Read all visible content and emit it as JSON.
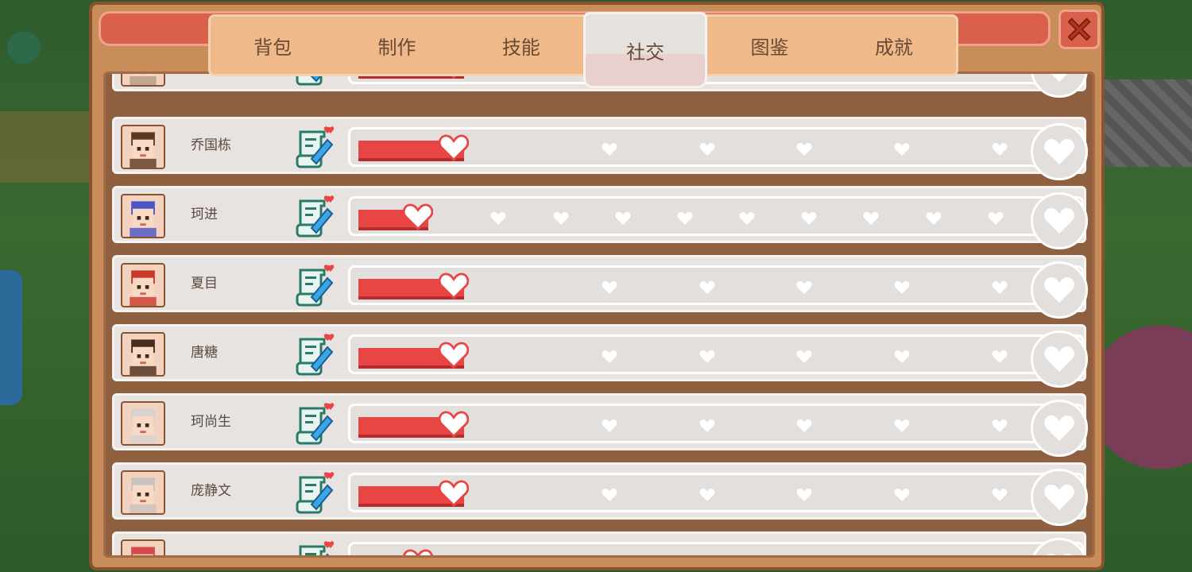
{
  "tabs": [
    {
      "label": "背包",
      "active": false
    },
    {
      "label": "制作",
      "active": false
    },
    {
      "label": "技能",
      "active": false
    },
    {
      "label": "社交",
      "active": true
    },
    {
      "label": "图鉴",
      "active": false
    },
    {
      "label": "成就",
      "active": false
    }
  ],
  "npcs": [
    {
      "name": "",
      "friendship_level": 1,
      "heart_slots": 6,
      "partial": true
    },
    {
      "name": "乔国栋",
      "friendship_level": 1,
      "heart_slots": 6
    },
    {
      "name": "珂进",
      "friendship_level": 1,
      "heart_slots": 10
    },
    {
      "name": "夏目",
      "friendship_level": 1,
      "heart_slots": 6
    },
    {
      "name": "唐糖",
      "friendship_level": 1,
      "heart_slots": 6
    },
    {
      "name": "珂尚生",
      "friendship_level": 1,
      "heart_slots": 6
    },
    {
      "name": "庞静文",
      "friendship_level": 1,
      "heart_slots": 6
    },
    {
      "name": "",
      "friendship_level": 1,
      "heart_slots": 10,
      "partial": true
    }
  ],
  "colors": {
    "heart_fill": "#e84545",
    "window": "#c98d5a",
    "tab_bg": "#efb98a",
    "title_bar": "#d9614c"
  },
  "icons": {
    "close": "close-icon",
    "gift": "gift-letter-icon",
    "heart": "heart-icon"
  }
}
